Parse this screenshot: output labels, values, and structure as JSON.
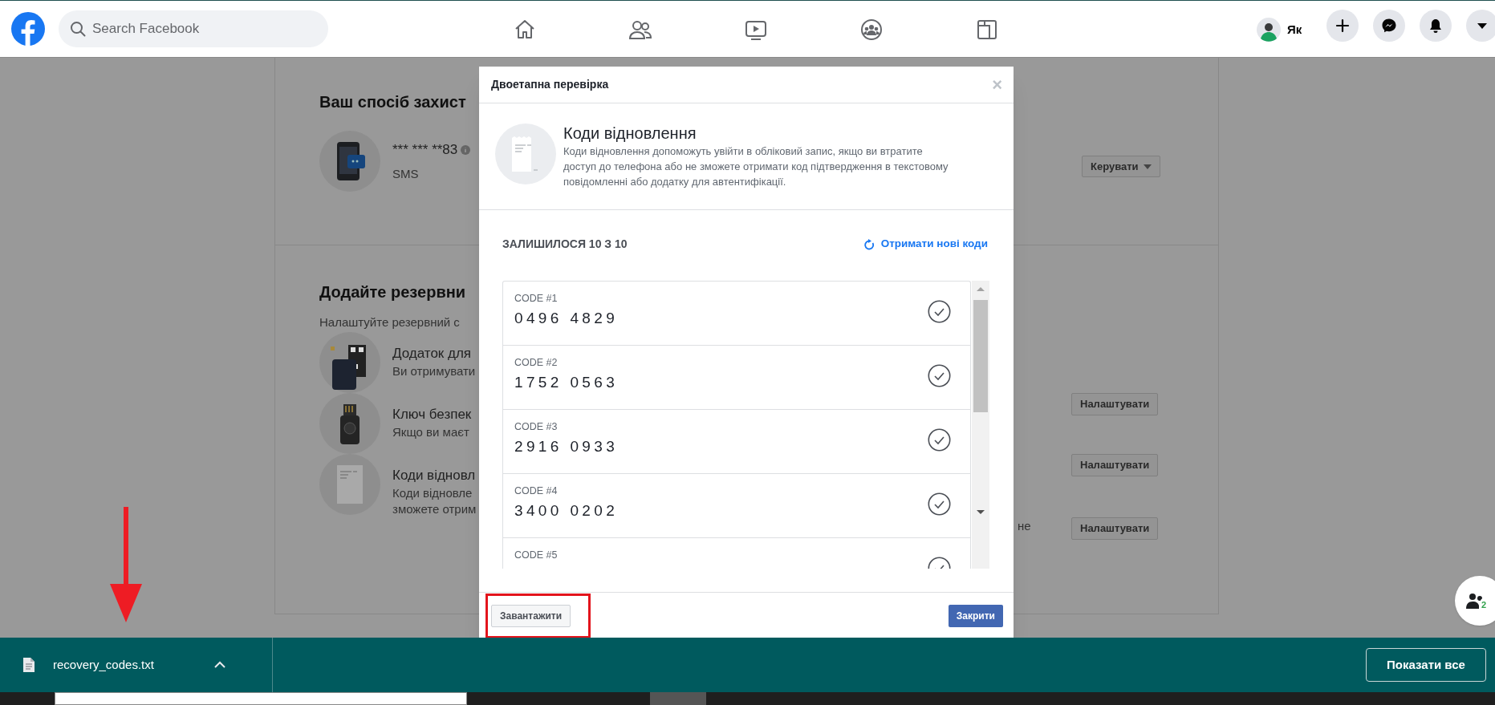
{
  "header": {
    "search": {
      "placeholder": "Search Facebook"
    },
    "profile_name": "Як"
  },
  "settings": {
    "method_title": "Ваш спосіб захист",
    "method": {
      "phone": "*** *** **83",
      "type": "SMS",
      "button": "Керувати"
    },
    "backup_title": "Додайте резервни",
    "backup_subtitle": "Налаштуйте резервний с",
    "backup_methods": [
      {
        "kind": "app",
        "title": "Додаток для",
        "lines": [
          "Ви отримувати"
        ],
        "button": "Налаштувати"
      },
      {
        "kind": "key",
        "title": "Ключ безпек",
        "lines": [
          "Якщо ви маєт"
        ],
        "button": "Налаштувати"
      },
      {
        "kind": "codes",
        "title": "Коди відновл",
        "lines": [
          "Коди відновле",
          "зможете отрим"
        ],
        "trailing": "не",
        "button": "Налаштувати"
      }
    ]
  },
  "dialog": {
    "title": "Двоетапна перевірка",
    "close": "×",
    "heading": "Коди відновлення",
    "description": "Коди відновлення допоможуть увійти в обліковий запис, якщо ви втратите доступ до телефона або не зможете отримати код підтвердження в текстовому повідомленні або додатку для автентифікації.",
    "remaining": "ЗАЛИШИЛОСЯ 10 З 10",
    "refresh_link": "Отримати нові коди",
    "codes": [
      {
        "label": "CODE #1",
        "code": "0496 4829"
      },
      {
        "label": "CODE #2",
        "code": "1752 0563"
      },
      {
        "label": "CODE #3",
        "code": "2916 0933"
      },
      {
        "label": "CODE #4",
        "code": "3400 0202"
      },
      {
        "label": "CODE #5"
      }
    ],
    "download_button": "Завантажити",
    "close_button": "Закрити"
  },
  "download_bar": {
    "file_name": "recovery_codes.txt",
    "show_all": "Показати все"
  },
  "chat_button": {
    "count": "2"
  }
}
